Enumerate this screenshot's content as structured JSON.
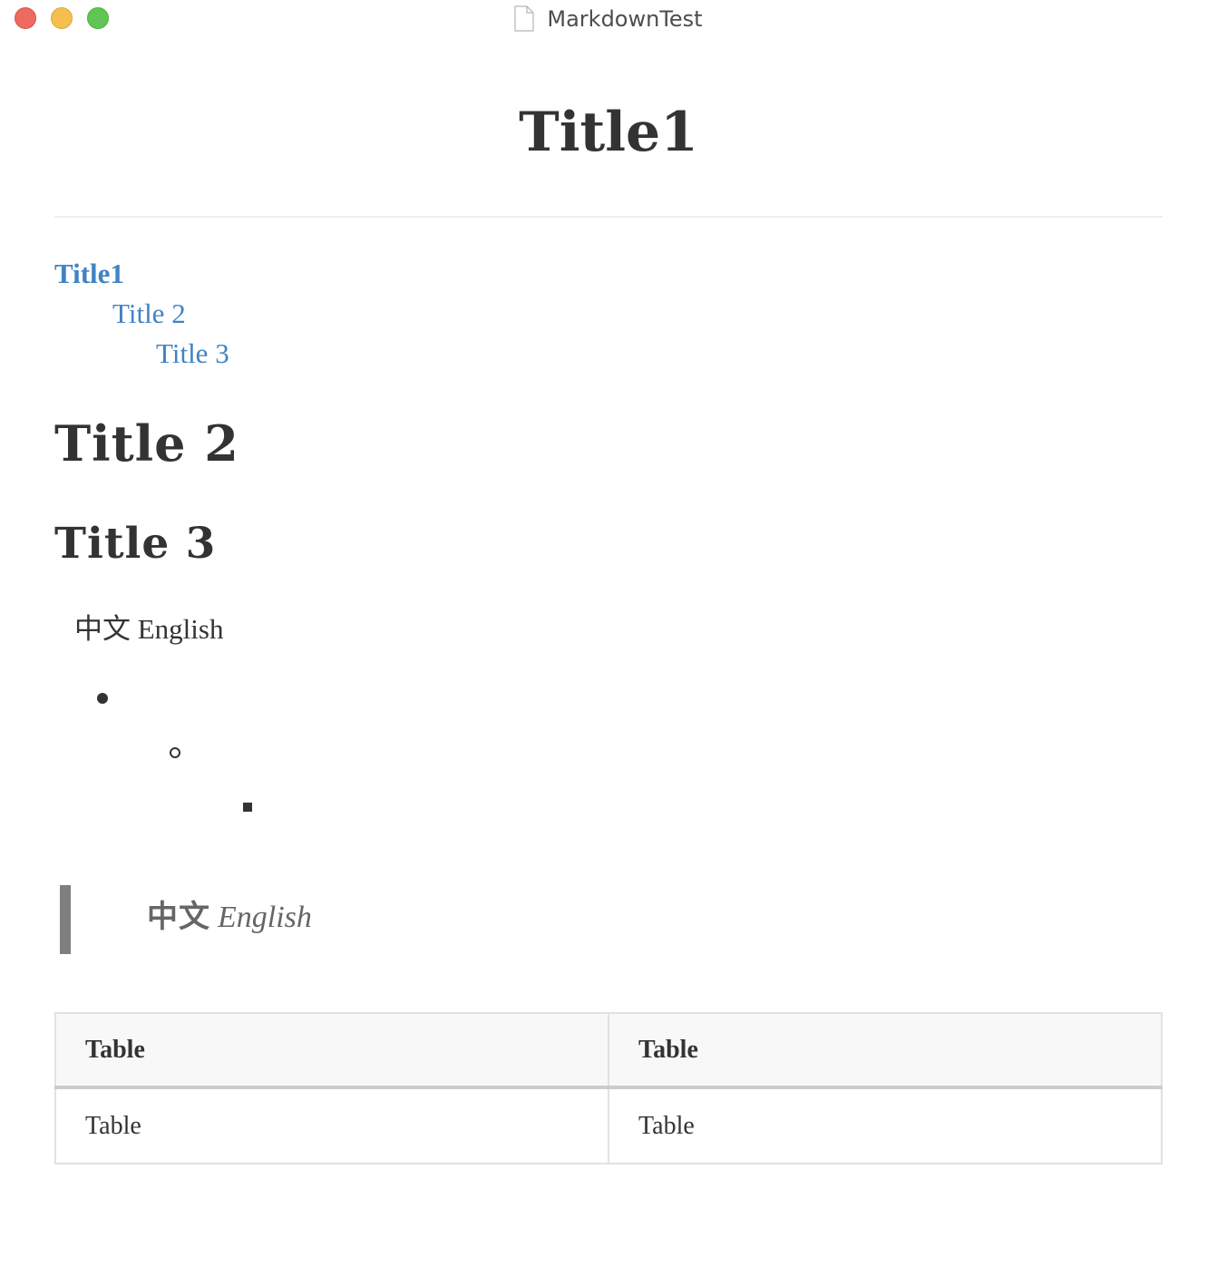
{
  "window": {
    "title": "MarkdownTest",
    "icon": "document-icon",
    "controls": [
      "close",
      "minimize",
      "maximize"
    ]
  },
  "document": {
    "h1": "Title1",
    "toc": [
      {
        "label": "Title1",
        "level": 1
      },
      {
        "label": "Title 2",
        "level": 2
      },
      {
        "label": "Title 3",
        "level": 3
      }
    ],
    "h2": "Title 2",
    "h3": "Title 3",
    "paragraph": "中文 English",
    "list": {
      "nesting_levels": 3,
      "markers": [
        "disc",
        "circle",
        "square"
      ],
      "items": [
        "",
        "",
        ""
      ]
    },
    "blockquote": {
      "chinese": "中文",
      "english": "English"
    },
    "table": {
      "headers": [
        "Table",
        "Table"
      ],
      "rows": [
        [
          "Table",
          "Table"
        ]
      ]
    }
  },
  "colors": {
    "link": "#4183c4",
    "text": "#333333",
    "quote_bar": "#7f7f7f",
    "table_header_bg": "#f8f8f8"
  }
}
